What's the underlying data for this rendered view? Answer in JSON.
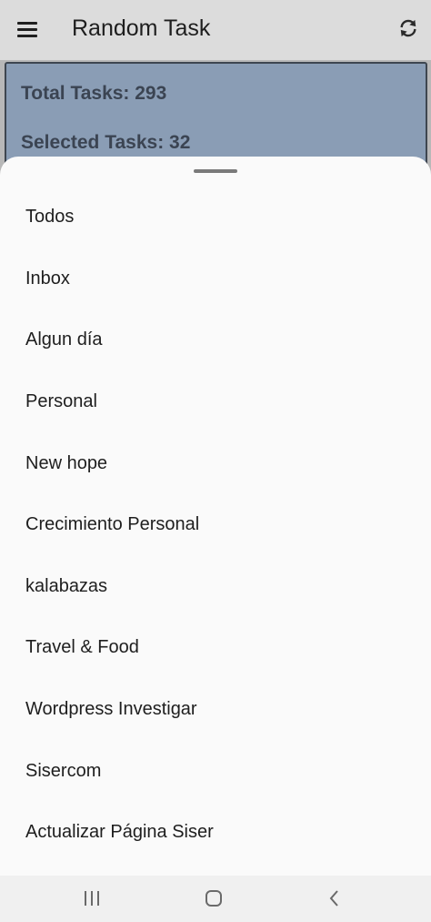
{
  "app_bar": {
    "title": "Random Task",
    "menu_icon": "hamburger-menu-icon",
    "refresh_icon": "refresh-icon"
  },
  "stats": {
    "total": "Total Tasks: 293",
    "selected": "Selected Tasks: 32",
    "card_color": "#8a9db5"
  },
  "sheet": {
    "items": [
      "Todos",
      "Inbox",
      "Algun día",
      "Personal",
      "New hope",
      "Crecimiento Personal",
      "kalabazas",
      "Travel & Food",
      "Wordpress Investigar",
      "Sisercom",
      "Actualizar Página Siser"
    ]
  },
  "nav_bar": {
    "recent_icon": "recent-apps-icon",
    "home_icon": "home-icon",
    "back_icon": "back-icon"
  }
}
